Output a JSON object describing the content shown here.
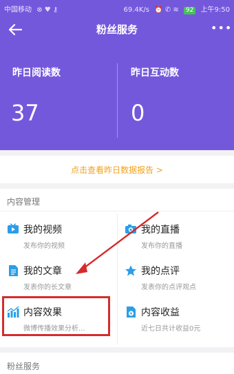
{
  "status": {
    "carrier": "中国移动",
    "speed": "69.4K/s",
    "battery": "92",
    "time": "上午9:50"
  },
  "nav": {
    "title": "粉丝服务"
  },
  "stats": [
    {
      "label": "昨日阅读数",
      "value": "37"
    },
    {
      "label": "昨日互动数",
      "value": "0"
    }
  ],
  "report_link": "点击查看昨日数据报告 >",
  "content_section": {
    "title": "内容管理",
    "tiles": [
      {
        "title": "我的视频",
        "subtitle": "发布你的视频",
        "icon": "video-icon",
        "color": "#2a9ee8"
      },
      {
        "title": "我的直播",
        "subtitle": "发布你的直播",
        "icon": "camera-icon",
        "color": "#2a9ee8"
      },
      {
        "title": "我的文章",
        "subtitle": "发表你的长文章",
        "icon": "document-icon",
        "color": "#2a9ee8"
      },
      {
        "title": "我的点评",
        "subtitle": "发表你的点评观点",
        "icon": "star-icon",
        "color": "#2a9ee8"
      },
      {
        "title": "内容效果",
        "subtitle": "微博传播效果分析...",
        "icon": "bar-chart-icon",
        "color": "#2a9ee8"
      },
      {
        "title": "内容收益",
        "subtitle": "近七日共计收益0元",
        "icon": "income-icon",
        "color": "#2a9ee8"
      }
    ]
  },
  "fans_section": {
    "title": "粉丝服务"
  },
  "colors": {
    "accent": "#7458dc",
    "highlight": "#d52b2b",
    "link": "#f2a11a",
    "icon": "#2a9ee8"
  }
}
